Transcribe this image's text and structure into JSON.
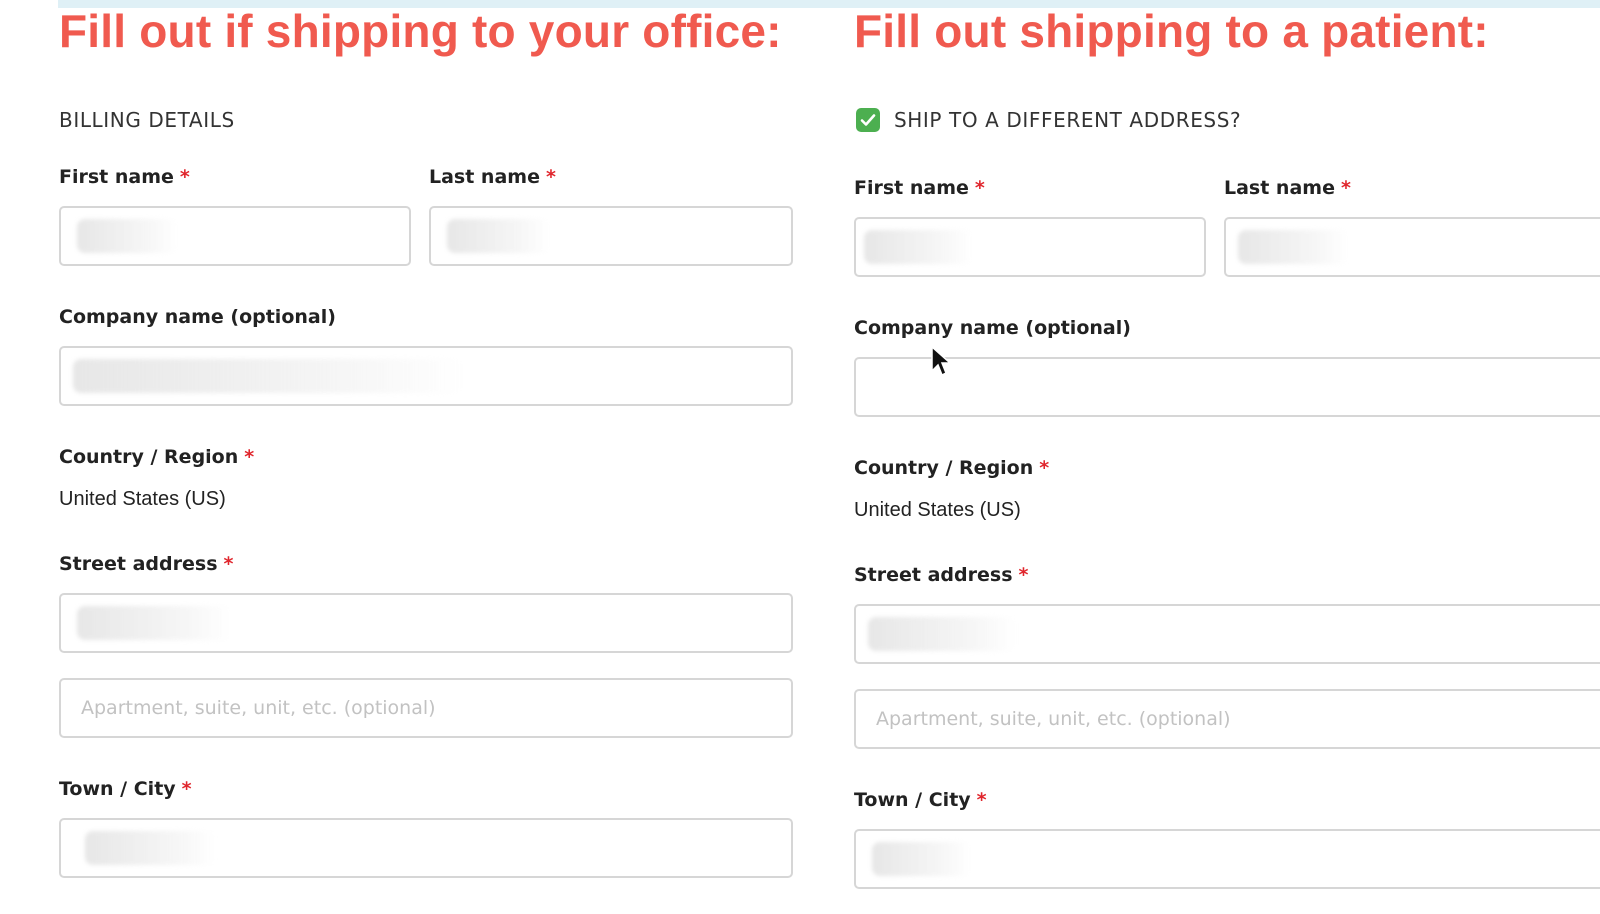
{
  "left": {
    "headline": "Fill out if shipping to your office:",
    "section_title": "BILLING DETAILS",
    "first_name_label": "First name",
    "last_name_label": "Last name",
    "company_label": "Company name (optional)",
    "country_label": "Country / Region",
    "country_value": "United States (US)",
    "street_label": "Street address",
    "apartment_placeholder": "Apartment, suite, unit, etc. (optional)",
    "city_label": "Town / City",
    "required_mark": "*"
  },
  "right": {
    "headline": "Fill out shipping to a patient:",
    "ship_label": "SHIP TO A DIFFERENT ADDRESS?",
    "ship_checked": true,
    "first_name_label": "First name",
    "last_name_label": "Last name",
    "company_label": "Company name (optional)",
    "country_label": "Country / Region",
    "country_value": "United States (US)",
    "street_label": "Street address",
    "apartment_placeholder": "Apartment, suite, unit, etc. (optional)",
    "city_label": "Town / City",
    "required_mark": "*"
  },
  "colors": {
    "headline": "#f05a4f",
    "required": "#e0262d",
    "checkbox": "#4caf50",
    "border": "#d6d6d6"
  },
  "icons": [
    "checkmark-icon",
    "mouse-cursor-icon"
  ]
}
